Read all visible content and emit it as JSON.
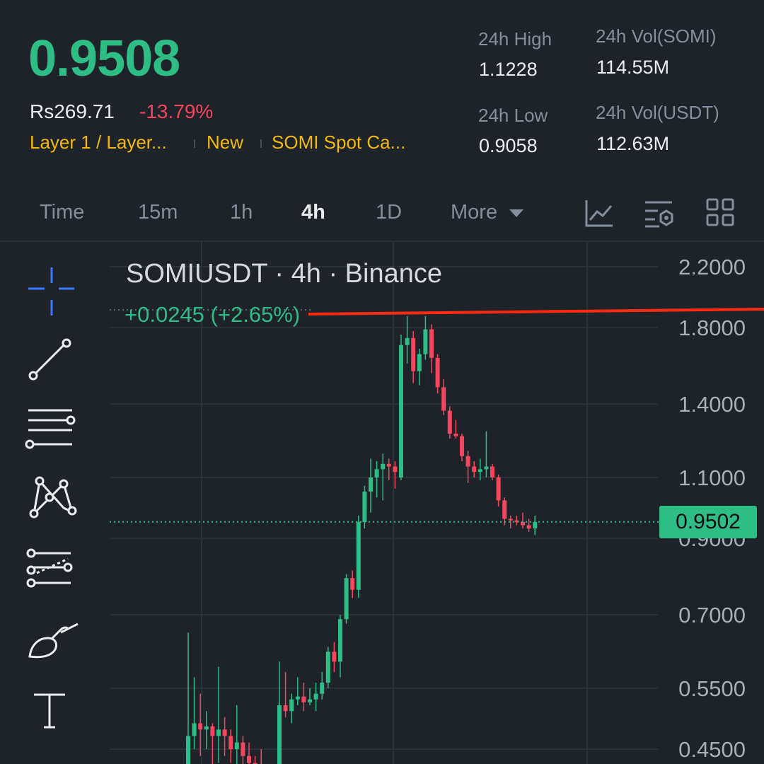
{
  "ticker": {
    "last_price": "0.9508",
    "fiat_price": "Rs269.71",
    "change_pct": "-13.79%",
    "tags": [
      "Layer 1 / Layer...",
      "New",
      "SOMI Spot Ca..."
    ]
  },
  "stats": {
    "high_label": "24h High",
    "high_value": "1.1228",
    "low_label": "24h Low",
    "low_value": "0.9058",
    "vol_base_label": "24h Vol(SOMI)",
    "vol_base_value": "114.55M",
    "vol_quote_label": "24h Vol(USDT)",
    "vol_quote_value": "112.63M"
  },
  "tabs": [
    {
      "label": "Time",
      "active": false
    },
    {
      "label": "15m",
      "active": false
    },
    {
      "label": "1h",
      "active": false
    },
    {
      "label": "4h",
      "active": true
    },
    {
      "label": "1D",
      "active": false
    },
    {
      "label": "More",
      "active": false
    }
  ],
  "tab_icons": [
    "indicator-chart-icon",
    "chart-settings-icon",
    "layout-grid-icon"
  ],
  "toolbar": [
    "crosshair-icon",
    "trend-line-icon",
    "horizontal-lines-icon",
    "pattern-icon",
    "fib-retracement-icon",
    "brush-icon",
    "text-tool-icon"
  ],
  "chart": {
    "title": "SOMIUSDT · 4h · Binance",
    "change_text": "+0.0245 (+2.65%)",
    "last_price_tag": "0.9502",
    "colors": {
      "up": "#2ebd85",
      "down": "#f6465d",
      "drawn_line": "#ff2a12",
      "background": "#1e2329",
      "grid": "#2b3139"
    }
  },
  "chart_data": {
    "type": "candlestick",
    "title": "SOMIUSDT · 4h · Binance",
    "y_axis_labels": [
      "2.2000",
      "1.8000",
      "1.4000",
      "1.1000",
      "0.9000",
      "0.7000",
      "0.5500",
      "0.4500"
    ],
    "y_scale": "log",
    "ylim": [
      0.43,
      2.3
    ],
    "last_price": 0.9502,
    "grid": true,
    "candles": [
      [
        0.4,
        0.66,
        0.38,
        0.47
      ],
      [
        0.47,
        0.57,
        0.45,
        0.49
      ],
      [
        0.49,
        0.54,
        0.44,
        0.48
      ],
      [
        0.48,
        0.51,
        0.45,
        0.485
      ],
      [
        0.485,
        0.49,
        0.42,
        0.47
      ],
      [
        0.47,
        0.59,
        0.43,
        0.48
      ],
      [
        0.48,
        0.5,
        0.44,
        0.47
      ],
      [
        0.47,
        0.48,
        0.43,
        0.45
      ],
      [
        0.45,
        0.52,
        0.42,
        0.46
      ],
      [
        0.46,
        0.47,
        0.42,
        0.44
      ],
      [
        0.44,
        0.46,
        0.42,
        0.43
      ],
      [
        0.43,
        0.44,
        0.4,
        0.42
      ],
      [
        0.42,
        0.45,
        0.4,
        0.41
      ],
      [
        0.41,
        0.42,
        0.38,
        0.4
      ],
      [
        0.4,
        0.4,
        0.37,
        0.38
      ],
      [
        0.4,
        0.6,
        0.38,
        0.52
      ],
      [
        0.52,
        0.58,
        0.5,
        0.51
      ],
      [
        0.51,
        0.54,
        0.49,
        0.53
      ],
      [
        0.53,
        0.57,
        0.52,
        0.535
      ],
      [
        0.535,
        0.56,
        0.51,
        0.525
      ],
      [
        0.525,
        0.55,
        0.52,
        0.53
      ],
      [
        0.53,
        0.56,
        0.51,
        0.54
      ],
      [
        0.54,
        0.58,
        0.53,
        0.56
      ],
      [
        0.56,
        0.63,
        0.55,
        0.62
      ],
      [
        0.62,
        0.64,
        0.58,
        0.6
      ],
      [
        0.6,
        0.7,
        0.57,
        0.69
      ],
      [
        0.69,
        0.8,
        0.68,
        0.79
      ],
      [
        0.79,
        0.81,
        0.74,
        0.76
      ],
      [
        0.76,
        0.97,
        0.74,
        0.95
      ],
      [
        0.95,
        1.07,
        0.93,
        1.05
      ],
      [
        1.05,
        1.17,
        0.98,
        1.1
      ],
      [
        1.1,
        1.16,
        1.03,
        1.13
      ],
      [
        1.13,
        1.19,
        1.02,
        1.15
      ],
      [
        1.15,
        1.17,
        1.09,
        1.14
      ],
      [
        1.14,
        1.16,
        1.06,
        1.12
      ],
      [
        1.1,
        1.76,
        1.09,
        1.7
      ],
      [
        1.7,
        1.87,
        1.6,
        1.74
      ],
      [
        1.74,
        1.78,
        1.5,
        1.56
      ],
      [
        1.56,
        1.68,
        1.49,
        1.65
      ],
      [
        1.65,
        1.87,
        1.62,
        1.79
      ],
      [
        1.79,
        1.82,
        1.55,
        1.63
      ],
      [
        1.63,
        1.65,
        1.45,
        1.48
      ],
      [
        1.48,
        1.52,
        1.35,
        1.37
      ],
      [
        1.37,
        1.39,
        1.25,
        1.27
      ],
      [
        1.27,
        1.33,
        1.25,
        1.26
      ],
      [
        1.26,
        1.27,
        1.16,
        1.18
      ],
      [
        1.18,
        1.2,
        1.08,
        1.14
      ],
      [
        1.14,
        1.16,
        1.1,
        1.12
      ],
      [
        1.12,
        1.17,
        1.09,
        1.13
      ],
      [
        1.13,
        1.28,
        1.1,
        1.14
      ],
      [
        1.14,
        1.15,
        1.09,
        1.1
      ],
      [
        1.1,
        1.11,
        1.0,
        1.02
      ],
      [
        1.02,
        1.03,
        0.94,
        0.96
      ],
      [
        0.96,
        0.97,
        0.93,
        0.955
      ],
      [
        0.955,
        0.97,
        0.94,
        0.95
      ],
      [
        0.95,
        0.98,
        0.93,
        0.94
      ],
      [
        0.94,
        0.96,
        0.92,
        0.93
      ],
      [
        0.93,
        0.97,
        0.91,
        0.95
      ]
    ],
    "horizontal_line": {
      "price": 1.9,
      "color": "#ff2a12"
    }
  }
}
